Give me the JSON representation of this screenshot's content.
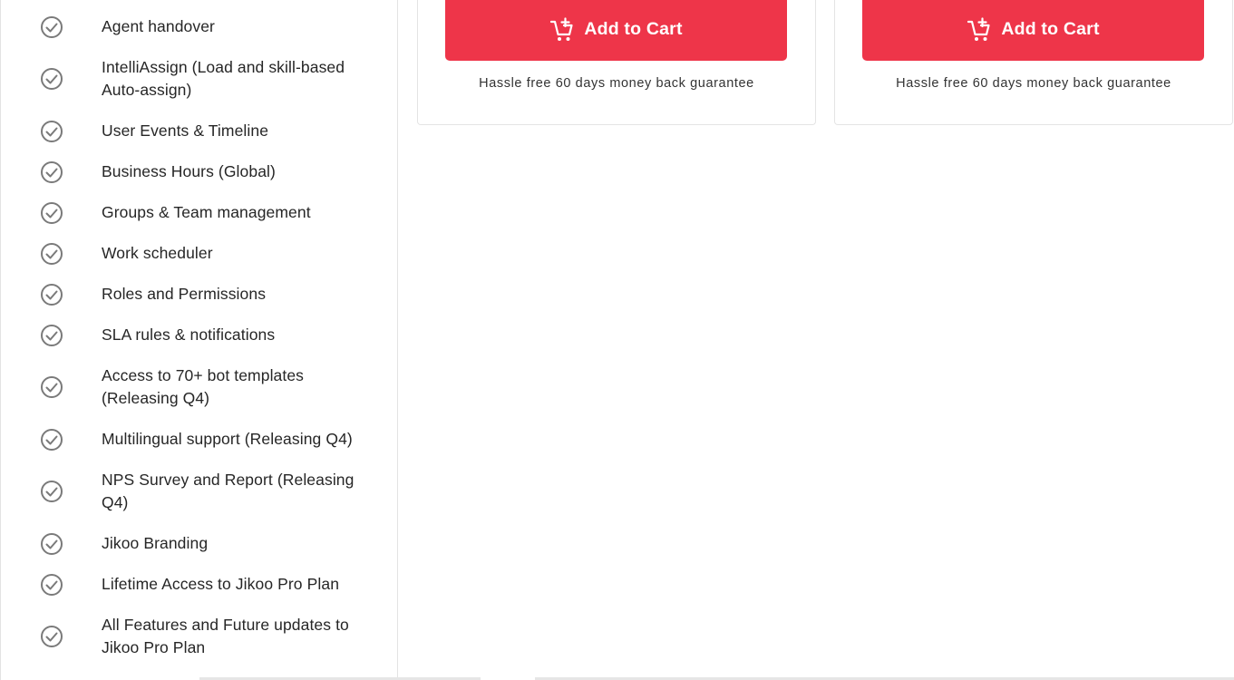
{
  "features": [
    {
      "label": "Agent handover"
    },
    {
      "label": "IntelliAssign (Load and skill-based Auto-assign)"
    },
    {
      "label": "User Events & Timeline"
    },
    {
      "label": "Business Hours (Global)"
    },
    {
      "label": "Groups & Team management"
    },
    {
      "label": "Work scheduler"
    },
    {
      "label": "Roles and Permissions"
    },
    {
      "label": "SLA rules & notifications"
    },
    {
      "label": "Access to 70+ bot templates (Releasing Q4)"
    },
    {
      "label": "Multilingual support (Releasing Q4)"
    },
    {
      "label": "NPS Survey and Report (Releasing Q4)"
    },
    {
      "label": "Jikoo Branding"
    },
    {
      "label": "Lifetime Access to Jikoo Pro Plan"
    },
    {
      "label": "All Features and Future updates to Jikoo Pro Plan"
    }
  ],
  "plans": [
    {
      "button_label": "Add to Cart",
      "guarantee": "Hassle free 60 days money back guarantee"
    },
    {
      "button_label": "Add to Cart",
      "guarantee": "Hassle free 60 days money back guarantee"
    }
  ],
  "colors": {
    "accent": "#ee3549",
    "check": "#7a7a7a"
  },
  "icons": {
    "feature": "check-circle-icon",
    "button": "add-cart-icon"
  }
}
